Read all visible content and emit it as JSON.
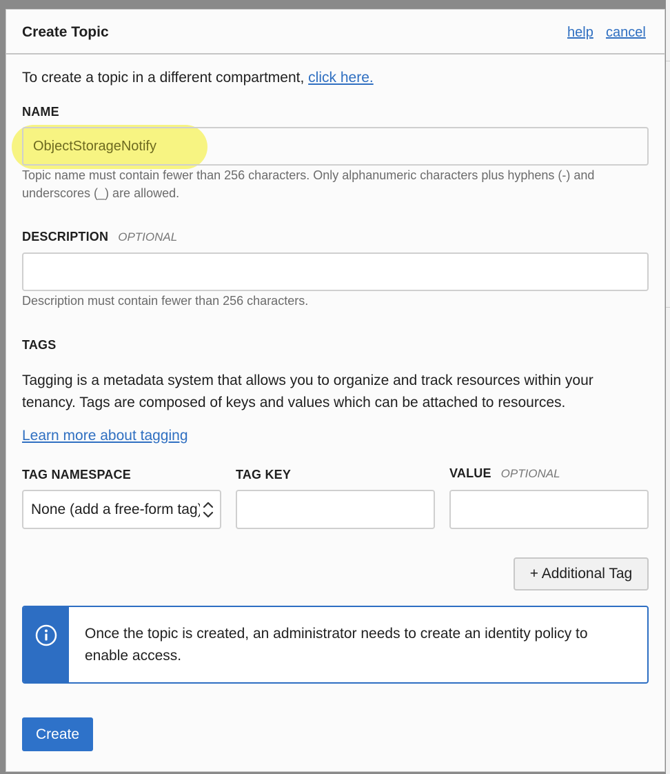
{
  "dialog": {
    "title": "Create Topic",
    "help_link": "help",
    "cancel_link": "cancel"
  },
  "intro": {
    "text": "To create a topic in a different compartment, ",
    "link": "click here."
  },
  "name": {
    "label": "NAME",
    "value": "ObjectStorageNotify",
    "hint": "Topic name must contain fewer than 256 characters. Only alphanumeric characters plus hyphens (-) and underscores (_) are allowed."
  },
  "description": {
    "label": "DESCRIPTION",
    "optional": "OPTIONAL",
    "value": "",
    "hint": "Description must contain fewer than 256 characters."
  },
  "tags": {
    "heading": "TAGS",
    "text": "Tagging is a metadata system that allows you to organize and track resources within your tenancy. Tags are composed of keys and values which can be attached to resources.",
    "learn_link": "Learn more about tagging",
    "namespace_label": "TAG NAMESPACE",
    "namespace_value": "None (add a free-form tag)",
    "key_label": "TAG KEY",
    "key_value": "",
    "value_label": "VALUE",
    "value_optional": "OPTIONAL",
    "value_value": "",
    "add_button": "+ Additional Tag"
  },
  "info": {
    "icon": "info-circle-icon",
    "text": "Once the topic is created, an administrator needs to create an identity policy to enable access."
  },
  "actions": {
    "create_button": "Create"
  },
  "colors": {
    "accent": "#2e72c9",
    "link": "#2f6fc1",
    "highlight": "#f6f26c"
  }
}
